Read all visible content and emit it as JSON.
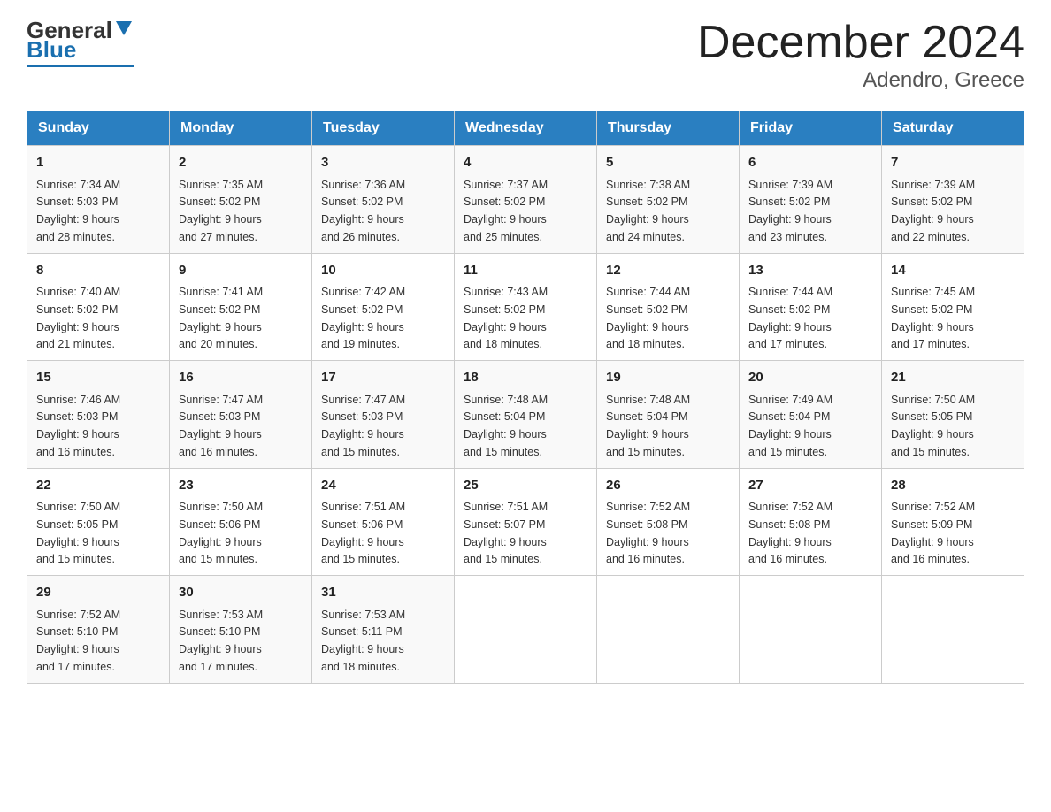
{
  "header": {
    "logo_general": "General",
    "logo_blue": "Blue",
    "title": "December 2024",
    "subtitle": "Adendro, Greece"
  },
  "days_of_week": [
    "Sunday",
    "Monday",
    "Tuesday",
    "Wednesday",
    "Thursday",
    "Friday",
    "Saturday"
  ],
  "weeks": [
    [
      {
        "day": "1",
        "sunrise": "7:34 AM",
        "sunset": "5:03 PM",
        "daylight": "9 hours and 28 minutes."
      },
      {
        "day": "2",
        "sunrise": "7:35 AM",
        "sunset": "5:02 PM",
        "daylight": "9 hours and 27 minutes."
      },
      {
        "day": "3",
        "sunrise": "7:36 AM",
        "sunset": "5:02 PM",
        "daylight": "9 hours and 26 minutes."
      },
      {
        "day": "4",
        "sunrise": "7:37 AM",
        "sunset": "5:02 PM",
        "daylight": "9 hours and 25 minutes."
      },
      {
        "day": "5",
        "sunrise": "7:38 AM",
        "sunset": "5:02 PM",
        "daylight": "9 hours and 24 minutes."
      },
      {
        "day": "6",
        "sunrise": "7:39 AM",
        "sunset": "5:02 PM",
        "daylight": "9 hours and 23 minutes."
      },
      {
        "day": "7",
        "sunrise": "7:39 AM",
        "sunset": "5:02 PM",
        "daylight": "9 hours and 22 minutes."
      }
    ],
    [
      {
        "day": "8",
        "sunrise": "7:40 AM",
        "sunset": "5:02 PM",
        "daylight": "9 hours and 21 minutes."
      },
      {
        "day": "9",
        "sunrise": "7:41 AM",
        "sunset": "5:02 PM",
        "daylight": "9 hours and 20 minutes."
      },
      {
        "day": "10",
        "sunrise": "7:42 AM",
        "sunset": "5:02 PM",
        "daylight": "9 hours and 19 minutes."
      },
      {
        "day": "11",
        "sunrise": "7:43 AM",
        "sunset": "5:02 PM",
        "daylight": "9 hours and 18 minutes."
      },
      {
        "day": "12",
        "sunrise": "7:44 AM",
        "sunset": "5:02 PM",
        "daylight": "9 hours and 18 minutes."
      },
      {
        "day": "13",
        "sunrise": "7:44 AM",
        "sunset": "5:02 PM",
        "daylight": "9 hours and 17 minutes."
      },
      {
        "day": "14",
        "sunrise": "7:45 AM",
        "sunset": "5:02 PM",
        "daylight": "9 hours and 17 minutes."
      }
    ],
    [
      {
        "day": "15",
        "sunrise": "7:46 AM",
        "sunset": "5:03 PM",
        "daylight": "9 hours and 16 minutes."
      },
      {
        "day": "16",
        "sunrise": "7:47 AM",
        "sunset": "5:03 PM",
        "daylight": "9 hours and 16 minutes."
      },
      {
        "day": "17",
        "sunrise": "7:47 AM",
        "sunset": "5:03 PM",
        "daylight": "9 hours and 15 minutes."
      },
      {
        "day": "18",
        "sunrise": "7:48 AM",
        "sunset": "5:04 PM",
        "daylight": "9 hours and 15 minutes."
      },
      {
        "day": "19",
        "sunrise": "7:48 AM",
        "sunset": "5:04 PM",
        "daylight": "9 hours and 15 minutes."
      },
      {
        "day": "20",
        "sunrise": "7:49 AM",
        "sunset": "5:04 PM",
        "daylight": "9 hours and 15 minutes."
      },
      {
        "day": "21",
        "sunrise": "7:50 AM",
        "sunset": "5:05 PM",
        "daylight": "9 hours and 15 minutes."
      }
    ],
    [
      {
        "day": "22",
        "sunrise": "7:50 AM",
        "sunset": "5:05 PM",
        "daylight": "9 hours and 15 minutes."
      },
      {
        "day": "23",
        "sunrise": "7:50 AM",
        "sunset": "5:06 PM",
        "daylight": "9 hours and 15 minutes."
      },
      {
        "day": "24",
        "sunrise": "7:51 AM",
        "sunset": "5:06 PM",
        "daylight": "9 hours and 15 minutes."
      },
      {
        "day": "25",
        "sunrise": "7:51 AM",
        "sunset": "5:07 PM",
        "daylight": "9 hours and 15 minutes."
      },
      {
        "day": "26",
        "sunrise": "7:52 AM",
        "sunset": "5:08 PM",
        "daylight": "9 hours and 16 minutes."
      },
      {
        "day": "27",
        "sunrise": "7:52 AM",
        "sunset": "5:08 PM",
        "daylight": "9 hours and 16 minutes."
      },
      {
        "day": "28",
        "sunrise": "7:52 AM",
        "sunset": "5:09 PM",
        "daylight": "9 hours and 16 minutes."
      }
    ],
    [
      {
        "day": "29",
        "sunrise": "7:52 AM",
        "sunset": "5:10 PM",
        "daylight": "9 hours and 17 minutes."
      },
      {
        "day": "30",
        "sunrise": "7:53 AM",
        "sunset": "5:10 PM",
        "daylight": "9 hours and 17 minutes."
      },
      {
        "day": "31",
        "sunrise": "7:53 AM",
        "sunset": "5:11 PM",
        "daylight": "9 hours and 18 minutes."
      },
      null,
      null,
      null,
      null
    ]
  ],
  "labels": {
    "sunrise": "Sunrise:",
    "sunset": "Sunset:",
    "daylight": "Daylight:"
  }
}
